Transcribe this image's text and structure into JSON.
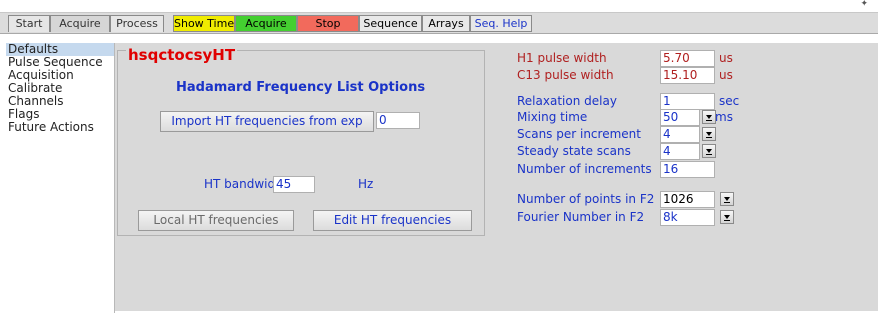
{
  "tabs": [
    "Start",
    "Acquire",
    "Process"
  ],
  "toolbar_buttons": [
    {
      "label": "Show Time",
      "color": "#f0ec00"
    },
    {
      "label": "Acquire",
      "color": "#44cf30"
    },
    {
      "label": "Stop",
      "color": "#f26a5c"
    },
    {
      "label": "Sequence",
      "color": "#e8e8e8"
    },
    {
      "label": "Arrays",
      "color": "#e8e8e8"
    },
    {
      "label": "Seq. Help",
      "color": "#e8e8e8"
    }
  ],
  "sidebar": {
    "items": [
      "Defaults",
      "Pulse Sequence",
      "Acquisition",
      "Calibrate",
      "Channels",
      "Flags",
      "Future Actions"
    ],
    "selected": "Defaults"
  },
  "panel": {
    "sequence_name": "hsqctocsyHT",
    "heading": "Hadamard Frequency List Options",
    "import_button": "Import HT frequencies from exp",
    "import_value": "0",
    "bandwidth_label": "HT bandwidth",
    "bandwidth_value": "45",
    "bandwidth_unit": "Hz",
    "local_button": "Local HT frequencies",
    "edit_button": "Edit HT frequencies"
  },
  "params": {
    "h1_pw": {
      "label": "H1 pulse width",
      "value": "5.70",
      "unit": "us"
    },
    "c13_pw": {
      "label": "C13 pulse width",
      "value": "15.10",
      "unit": "us"
    },
    "relax": {
      "label": "Relaxation delay",
      "value": "1",
      "unit": "sec"
    },
    "mix": {
      "label": "Mixing time",
      "value": "50",
      "unit": "ms"
    },
    "scans": {
      "label": "Scans per increment",
      "value": "4"
    },
    "ss": {
      "label": "Steady state scans",
      "value": "4"
    },
    "ni": {
      "label": "Number of increments",
      "value": "16"
    },
    "np": {
      "label": "Number of points in F2",
      "value": "1026"
    },
    "fn": {
      "label": "Fourier Number in F2",
      "value": "8k"
    }
  },
  "colors": {
    "label_blue": "#1a33c8",
    "label_red": "#b02020",
    "title_red": "#e00000",
    "panel_bg": "#d9d9d9",
    "sidebar_selected": "#c5d9ee"
  }
}
